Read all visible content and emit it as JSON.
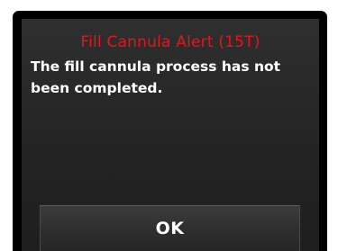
{
  "alert": {
    "title": "Fill Cannula Alert (15T)",
    "message": "The fill cannula process has not been completed.",
    "ok_label": "OK"
  },
  "colors": {
    "title": "#e8141b",
    "text": "#ffffff",
    "background": "#262626",
    "frame": "#000000"
  }
}
